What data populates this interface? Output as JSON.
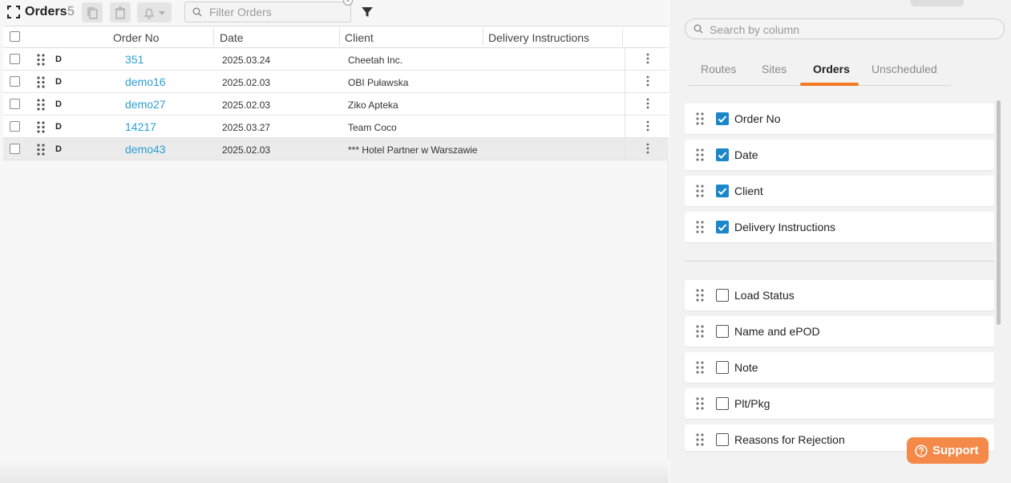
{
  "toolbar": {
    "title": "Orders",
    "count": "5",
    "filter_placeholder": "Filter Orders"
  },
  "table": {
    "columns": [
      "Order No",
      "Date",
      "Client",
      "Delivery Instructions"
    ],
    "rows": [
      {
        "tag": "D",
        "order_no": "351",
        "date": "2025.03.24",
        "client": "Cheetah Inc."
      },
      {
        "tag": "D",
        "order_no": "demo16",
        "date": "2025.02.03",
        "client": "OBI Puławska"
      },
      {
        "tag": "D",
        "order_no": "demo27",
        "date": "2025.02.03",
        "client": "Ziko Apteka"
      },
      {
        "tag": "D",
        "order_no": "14217",
        "date": "2025.03.27",
        "client": "Team Coco"
      },
      {
        "tag": "D",
        "order_no": "demo43",
        "date": "2025.02.03",
        "client": "*** Hotel Partner w Warszawie"
      }
    ]
  },
  "right_panel": {
    "search_placeholder": "Search by column",
    "tabs": [
      "Routes",
      "Sites",
      "Orders",
      "Unscheduled"
    ],
    "active_tab": "Orders",
    "visible_columns": [
      "Order No",
      "Date",
      "Client",
      "Delivery Instructions"
    ],
    "hidden_columns": [
      "Load Status",
      "Name and ePOD",
      "Note",
      "Plt/Pkg",
      "Reasons for Rejection"
    ],
    "support_label": "Support"
  },
  "colors": {
    "accent_orange": "#f07b22",
    "link_blue": "#2a9fd6",
    "checkbox_blue": "#1b87c9",
    "support_bg": "#f5894a"
  }
}
